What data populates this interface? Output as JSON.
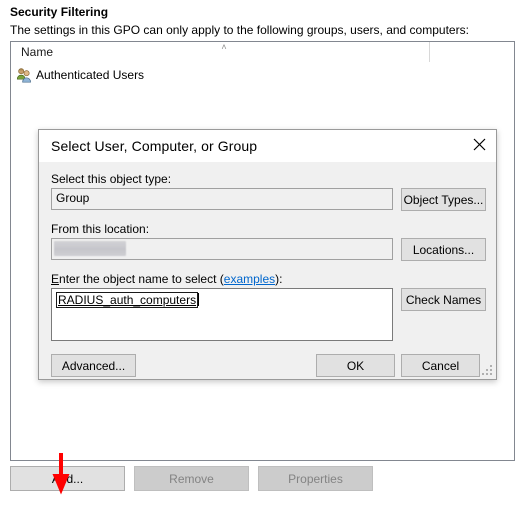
{
  "pane": {
    "title": "Security Filtering",
    "subtitle": "The settings in this GPO can only apply to the following groups, users, and computers:",
    "list": {
      "columns": [
        "Name"
      ],
      "sort_indicator": "˄",
      "rows": [
        {
          "icon": "users-group-icon",
          "name": "Authenticated Users"
        }
      ]
    },
    "commands": [
      {
        "id": "add",
        "label": "Add...",
        "enabled": true
      },
      {
        "id": "remove",
        "label": "Remove",
        "enabled": false
      },
      {
        "id": "properties",
        "label": "Properties",
        "enabled": false
      }
    ]
  },
  "annotation": {
    "type": "arrow-down",
    "color": "#ff0000",
    "points_to": "Add... button"
  },
  "dialog": {
    "title": "Select User, Computer, or Group",
    "close_label": "✕",
    "object_type": {
      "label": "Select this object type:",
      "value": "Group",
      "placeholder": "",
      "button": "Object Types..."
    },
    "location": {
      "label": "From this location:",
      "value": "",
      "redacted": true,
      "button": "Locations..."
    },
    "object_name": {
      "label_prefix": "E",
      "label_rest": "nter the object name to select (",
      "link": "examples",
      "label_suffix": "):",
      "value": "RADIUS_auth_computers",
      "resolved": true,
      "button": "Check Names"
    },
    "buttons": {
      "advanced": "Advanced...",
      "ok": "OK",
      "cancel": "Cancel"
    }
  }
}
